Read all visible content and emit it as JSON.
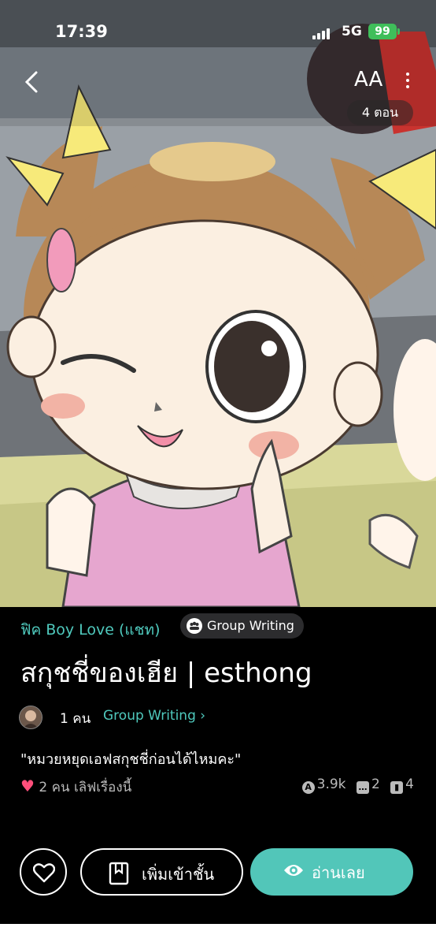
{
  "status_bar": {
    "time": "17:39",
    "network": "5G",
    "battery": "99"
  },
  "top_bar": {
    "font_size_label": "AA",
    "chapter_count": "4 ตอน"
  },
  "story": {
    "genre": "ฟิค Boy Love (แชท)",
    "writing_type": "Group Writing",
    "title": "สกุชชี่ของเฮีย | esthong",
    "writers": "1 คน",
    "writers_link": "Group Writing ›",
    "quote": "\"หมวยหยุดเอฟสกุชชี่ก่อนได้ไหมคะ\"",
    "likes": "2 คน เลิฟเรื่องนี้",
    "views": "3.9k",
    "comments": "2",
    "chapters": "4"
  },
  "actions": {
    "add_label": "เพิ่มเข้าชั้น",
    "read_label": "อ่านเลย"
  },
  "colors": {
    "accent": "#52c6b9",
    "heart": "#ff4f7b",
    "battery": "#3fbe5a"
  }
}
